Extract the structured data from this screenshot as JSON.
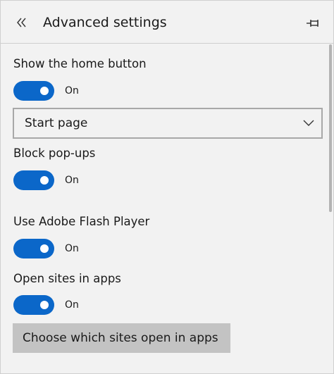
{
  "header": {
    "title": "Advanced settings",
    "back_icon": "double-chevron-left-icon",
    "pin_icon": "pin-icon"
  },
  "settings": {
    "home_button": {
      "label": "Show the home button",
      "state": "On",
      "enabled": true
    },
    "home_page_select": {
      "value": "Start page"
    },
    "block_popups": {
      "label": "Block pop-ups",
      "state": "On",
      "enabled": true
    },
    "flash_player": {
      "label": "Use Adobe Flash Player",
      "state": "On",
      "enabled": true
    },
    "open_sites_in_apps": {
      "label": "Open sites in apps",
      "state": "On",
      "enabled": true
    },
    "choose_sites_button": {
      "label": "Choose which sites open in apps"
    }
  },
  "colors": {
    "toggle_on": "#0b67c9",
    "background": "#f2f2f2",
    "button_bg": "#c3c3c3"
  }
}
